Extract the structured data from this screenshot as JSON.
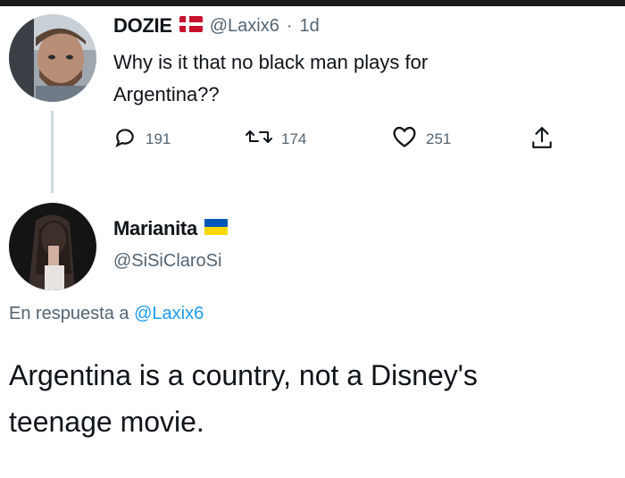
{
  "tweet1": {
    "display_name": "DOZIE",
    "handle": "@Laxix6",
    "separator": "·",
    "time": "1d",
    "text_line1": "Why is it that no black man plays for",
    "text_line2": "Argentina??",
    "replies": "191",
    "retweets": "174",
    "likes": "251"
  },
  "tweet2": {
    "display_name": "Marianita",
    "handle": "@SiSiClaroSi",
    "reply_prefix": "En respuesta a",
    "reply_to_handle": "@Laxix6",
    "text_line1": "Argentina is a country, not a Disney's",
    "text_line2": "teenage movie."
  },
  "icons": {
    "reply": "reply-icon",
    "retweet": "retweet-icon",
    "like": "heart-icon",
    "share": "share-icon"
  },
  "colors": {
    "text": "#0f1419",
    "muted": "#536471",
    "link": "#1d9bf0",
    "thread_line": "#cfd9de"
  }
}
